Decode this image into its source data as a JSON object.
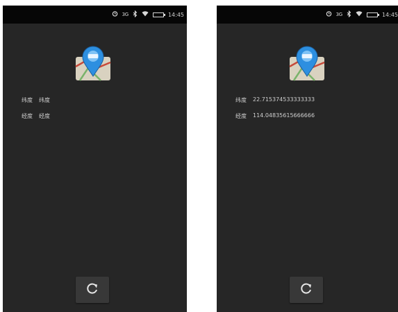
{
  "status_bar": {
    "network": "3G",
    "time": "14:45",
    "icons": [
      "alarm-icon",
      "bluetooth-icon",
      "wifi-icon",
      "battery-icon"
    ]
  },
  "app_icon": "map-pin-icon",
  "left_screen": {
    "latitude_label": "纬度",
    "latitude_value": "纬度",
    "longitude_label": "经度",
    "longitude_value": "经度"
  },
  "right_screen": {
    "latitude_label": "纬度",
    "latitude_value": "22.715374533333333",
    "longitude_label": "经度",
    "longitude_value": "114.04835615666666"
  },
  "refresh_icon": "refresh-icon",
  "colors": {
    "screen_bg": "#262626",
    "status_bar_bg": "#060606",
    "button_bg": "#383838",
    "pin_blue": "#2d8fe0"
  }
}
